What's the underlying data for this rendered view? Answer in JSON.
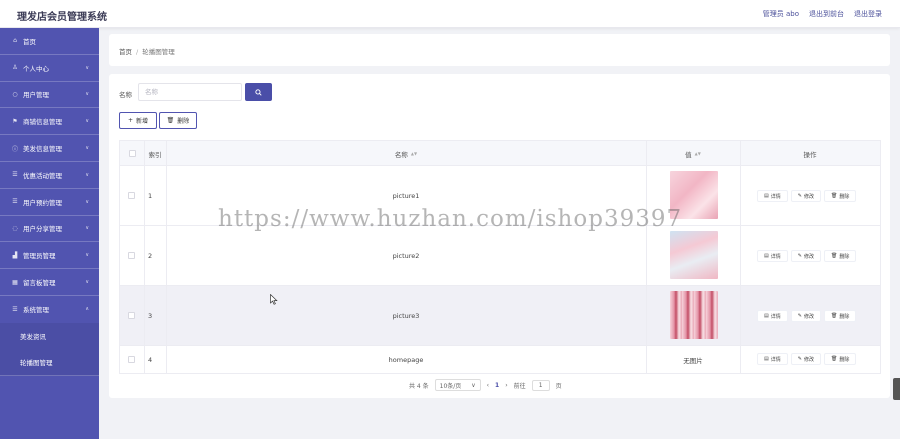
{
  "header": {
    "title": "理发店会员管理系统",
    "user": "管理员 abo",
    "back_to_frontend": "退出到前台",
    "logout": "退出登录"
  },
  "sidebar": {
    "items": [
      {
        "label": "首页",
        "icon": "home-icon"
      },
      {
        "label": "个人中心",
        "icon": "person-icon"
      },
      {
        "label": "用户管理",
        "icon": "user-circle-icon"
      },
      {
        "label": "商铺信息管理",
        "icon": "flag-icon"
      },
      {
        "label": "美发信息管理",
        "icon": "info-icon"
      },
      {
        "label": "优惠活动管理",
        "icon": "list-icon"
      },
      {
        "label": "用户预约管理",
        "icon": "list-icon"
      },
      {
        "label": "用户分享管理",
        "icon": "share-icon"
      },
      {
        "label": "管理员管理",
        "icon": "chart-icon"
      },
      {
        "label": "留言板管理",
        "icon": "message-icon"
      },
      {
        "label": "系统管理",
        "icon": "settings-icon"
      }
    ],
    "sub_items": [
      {
        "label": "美发资讯"
      },
      {
        "label": "轮播图管理"
      }
    ]
  },
  "breadcrumb": {
    "home": "首页",
    "separator": "/",
    "current": "轮播图管理"
  },
  "search": {
    "label": "名称",
    "placeholder": "名称"
  },
  "toolbar": {
    "add_label": "新增",
    "delete_label": "删除"
  },
  "table": {
    "headers": {
      "index": "索引",
      "name": "名称",
      "value": "值",
      "actions": "操作"
    },
    "rows": [
      {
        "index": "1",
        "name": "picture1",
        "has_image": true,
        "value_text": "",
        "image_color": "#f3c7d3"
      },
      {
        "index": "2",
        "name": "picture2",
        "has_image": true,
        "value_text": "",
        "image_color": "#d8e8f3"
      },
      {
        "index": "3",
        "name": "picture3",
        "has_image": true,
        "value_text": "",
        "image_color": "#e8a8b5"
      },
      {
        "index": "4",
        "name": "homepage",
        "has_image": false,
        "value_text": "无图片",
        "image_color": ""
      }
    ],
    "row_actions": {
      "detail": "详情",
      "edit": "修改",
      "delete": "删除"
    }
  },
  "pagination": {
    "total": "共 4 条",
    "page_size": "10条/页",
    "current_page": "1",
    "goto_prefix": "前往",
    "goto_value": "1",
    "goto_suffix": "页"
  },
  "watermark": "https://www.huzhan.com/ishop39397",
  "colors": {
    "sidebar": "#5154b0",
    "accent": "#4a4ea8"
  }
}
